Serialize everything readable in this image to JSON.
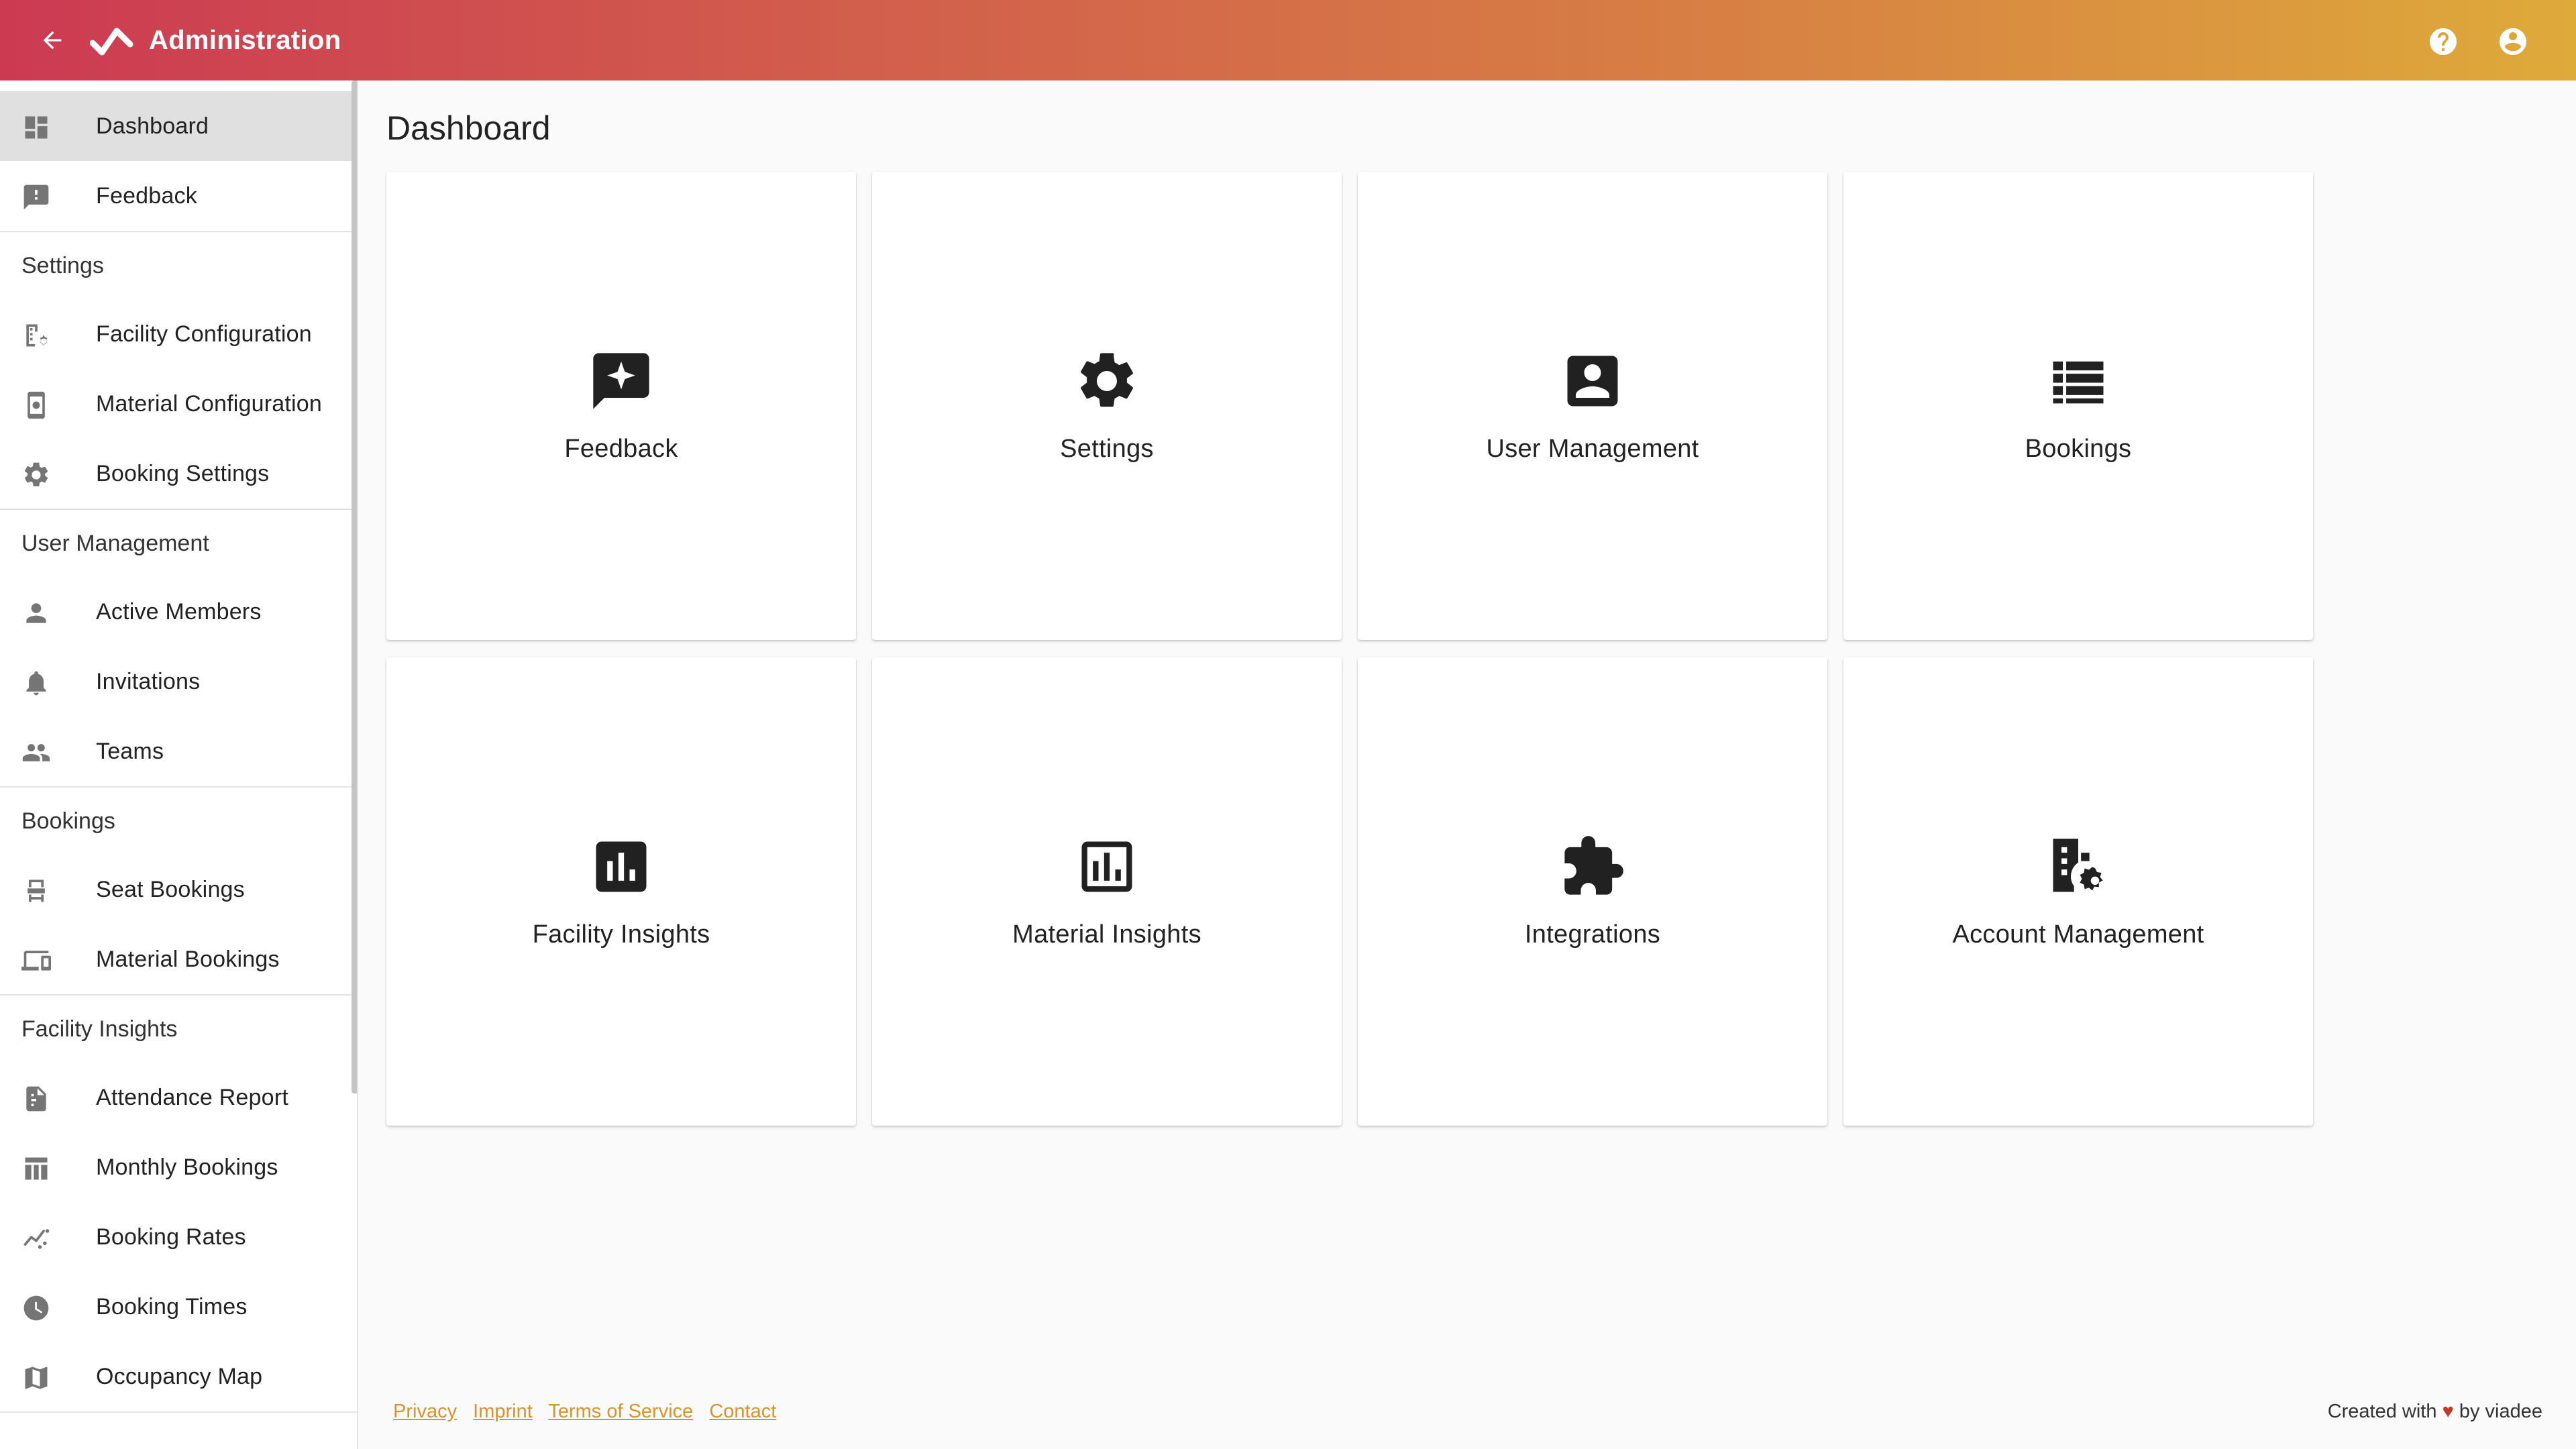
{
  "app": {
    "title": "Administration",
    "back_icon": "arrow-left-icon",
    "logo_icon": "check-chevron-logo",
    "help_icon": "help-circle-icon",
    "account_icon": "account-circle-icon"
  },
  "sidebar": {
    "top_items": [
      {
        "label": "Dashboard",
        "icon": "dashboard-icon",
        "active": true
      },
      {
        "label": "Feedback",
        "icon": "feedback-icon"
      }
    ],
    "sections": [
      {
        "title": "Settings",
        "items": [
          {
            "label": "Facility Configuration",
            "icon": "building-gear-icon"
          },
          {
            "label": "Material Configuration",
            "icon": "device-gear-icon"
          },
          {
            "label": "Booking Settings",
            "icon": "gear-icon"
          }
        ]
      },
      {
        "title": "User Management",
        "items": [
          {
            "label": "Active Members",
            "icon": "person-icon"
          },
          {
            "label": "Invitations",
            "icon": "bell-icon"
          },
          {
            "label": "Teams",
            "icon": "people-icon"
          }
        ]
      },
      {
        "title": "Bookings",
        "items": [
          {
            "label": "Seat Bookings",
            "icon": "seat-icon"
          },
          {
            "label": "Material Bookings",
            "icon": "devices-icon"
          }
        ]
      },
      {
        "title": "Facility Insights",
        "items": [
          {
            "label": "Attendance Report",
            "icon": "report-icon"
          },
          {
            "label": "Monthly Bookings",
            "icon": "table-icon"
          },
          {
            "label": "Booking Rates",
            "icon": "trend-icon"
          },
          {
            "label": "Booking Times",
            "icon": "clock-icon"
          },
          {
            "label": "Occupancy Map",
            "icon": "map-icon"
          }
        ]
      }
    ]
  },
  "main": {
    "title": "Dashboard",
    "cards": [
      {
        "label": "Feedback",
        "icon": "feedback-icon"
      },
      {
        "label": "Settings",
        "icon": "gear-icon"
      },
      {
        "label": "User Management",
        "icon": "account-box-icon"
      },
      {
        "label": "Bookings",
        "icon": "list-icon"
      },
      {
        "label": "Facility Insights",
        "icon": "bar-chart-icon"
      },
      {
        "label": "Material Insights",
        "icon": "bar-chart-outline-icon"
      },
      {
        "label": "Integrations",
        "icon": "puzzle-icon"
      },
      {
        "label": "Account Management",
        "icon": "building-gear-icon"
      }
    ]
  },
  "footer": {
    "links": [
      "Privacy",
      "Imprint",
      "Terms of Service",
      "Contact"
    ],
    "credit_prefix": "Created with",
    "credit_heart": "♥",
    "credit_suffix": "by viadee"
  },
  "colors": {
    "header_gradient_start": "#cc3a52",
    "header_gradient_end": "#deaa3a",
    "link": "#d9932e",
    "active_nav": "#e0e0e0"
  }
}
